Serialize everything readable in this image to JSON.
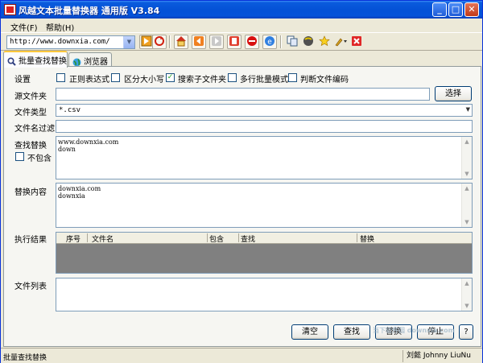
{
  "window": {
    "title": "风越文本批量替换器 通用版 V3.84",
    "btn_min": "_",
    "btn_max": "□",
    "btn_close": "✕"
  },
  "menu": {
    "file": "文件(F)",
    "help": "帮助(H)"
  },
  "toolbar": {
    "url": "http://www.downxia.com/",
    "combo_arrow": "▼"
  },
  "tabs": [
    {
      "label": "批量查找替换",
      "active": true
    },
    {
      "label": "浏览器",
      "active": false
    }
  ],
  "settings": {
    "label": "设置",
    "options": [
      {
        "label": "正则表达式",
        "checked": false,
        "mark": ""
      },
      {
        "label": "区分大小写",
        "checked": false,
        "mark": ""
      },
      {
        "label": "搜索子文件夹",
        "checked": true,
        "mark": "✓"
      },
      {
        "label": "多行批量模式",
        "checked": false,
        "mark": ""
      },
      {
        "label": "判断文件编码",
        "checked": false,
        "mark": ""
      }
    ]
  },
  "source_folder": {
    "label": "源文件夹",
    "value": "",
    "button": "选择"
  },
  "file_type": {
    "label": "文件类型",
    "value": "*.csv"
  },
  "file_filter": {
    "label": "文件名过滤",
    "value": ""
  },
  "find": {
    "label": "查找替换",
    "exclude_label": "不包含",
    "text": "www.downxia.com\ndown"
  },
  "replace": {
    "label": "替换内容",
    "text": "downxia.com\ndownxia"
  },
  "results": {
    "label": "执行结果",
    "columns": [
      "序号",
      "文件名",
      "包含",
      "查找",
      "替换"
    ]
  },
  "file_list": {
    "label": "文件列表"
  },
  "actions": {
    "clear": "清空",
    "find": "查找",
    "replace": "替换",
    "stop": "停止",
    "help": "?"
  },
  "status": {
    "left": "批量查找替换",
    "right": "刘懿 Johnny LiuNu"
  },
  "watermark": "当下软件园 downxia.com"
}
